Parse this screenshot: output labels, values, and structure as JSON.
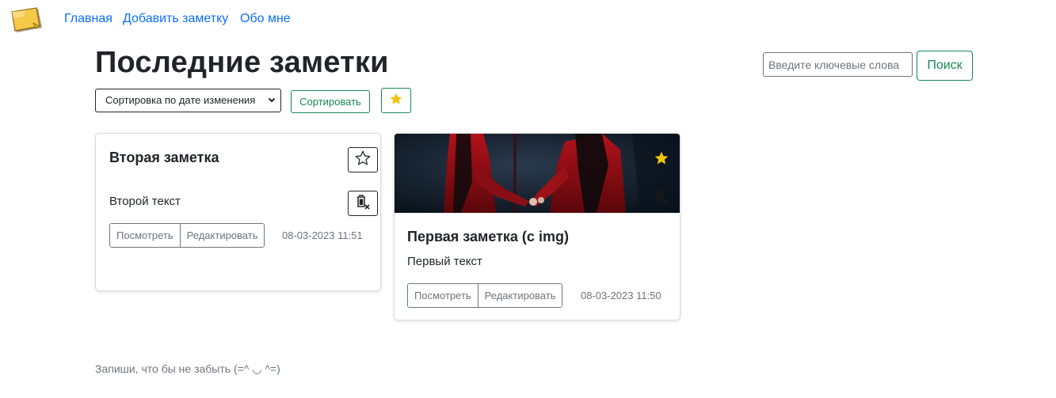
{
  "nav": {
    "links": [
      "Главная",
      "Добавить заметку",
      "Обо мне"
    ]
  },
  "page": {
    "title": "Последние заметки"
  },
  "search": {
    "placeholder": "Введите ключевые слова",
    "button_label": "Поиск"
  },
  "sort": {
    "selected": "Сортировка по дате изменения",
    "button_label": "Сортировать"
  },
  "notes": [
    {
      "title": "Вторая заметка",
      "text": "Второй текст",
      "view_label": "Посмотреть",
      "edit_label": "Редактировать",
      "date": "08-03-2023 11:51",
      "favorite": false,
      "has_image": false
    },
    {
      "title": "Первая заметка (с img)",
      "text": "Первый текст",
      "view_label": "Посмотреть",
      "edit_label": "Редактировать",
      "date": "08-03-2023 11:50",
      "favorite": true,
      "has_image": true
    }
  ],
  "footer": {
    "text": "Запиши, что бы не забыть (=^ ◡ ^=)"
  },
  "colors": {
    "link": "#0d6efd",
    "success": "#198754",
    "star": "#f4c20d",
    "muted": "#6c757d"
  }
}
